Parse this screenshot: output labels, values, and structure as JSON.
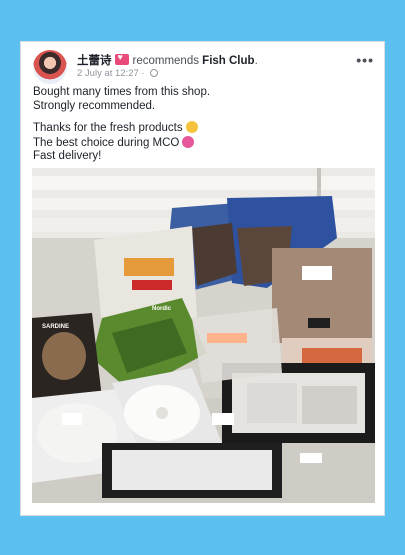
{
  "post": {
    "author": "土蕾诗",
    "action": "recommends",
    "page_name": "Fish Club",
    "page_suffix": ".",
    "date": "2 July at 12:27",
    "separator": "·",
    "more_label": "•••",
    "paragraphs": [
      [
        "Bought many times from this shop.",
        "Strongly recommended."
      ],
      [
        "Thanks for the fresh products",
        "The best choice during MCO",
        "Fast delivery!"
      ]
    ]
  },
  "photo": {
    "labels": [
      "SARDINE",
      "Nordic"
    ]
  },
  "colors": {
    "background": "#5bc0ef",
    "card": "#ffffff",
    "text": "#1d2129",
    "meta": "#90949c"
  }
}
